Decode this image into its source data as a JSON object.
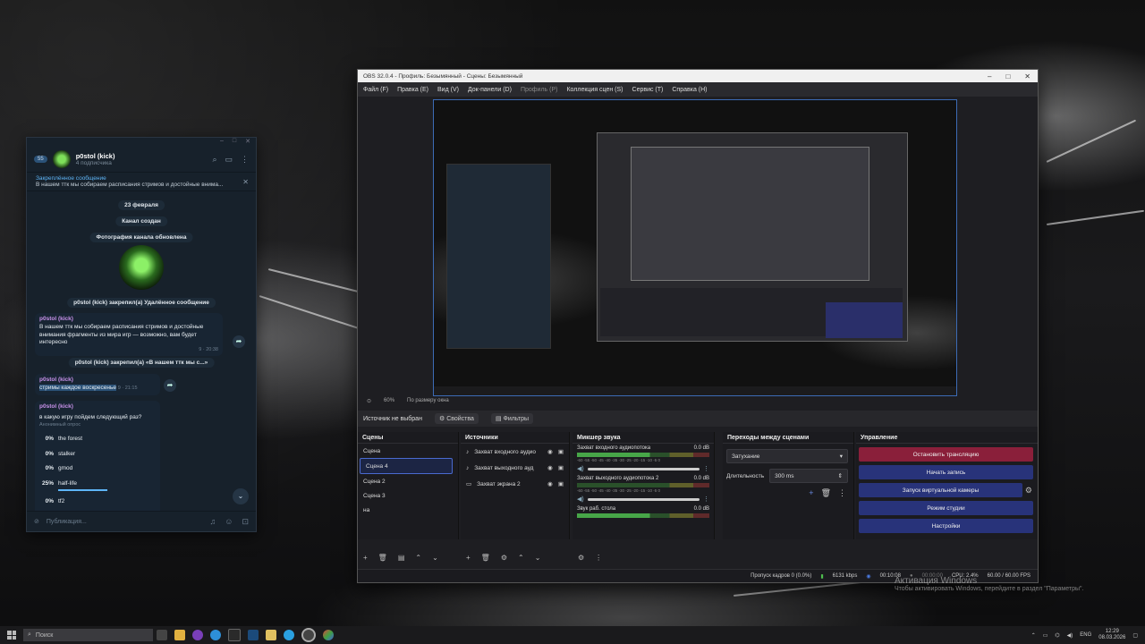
{
  "telegram": {
    "back_badge": "55",
    "channel_name": "p0stol (kick)",
    "subscribers": "4 подписчика",
    "pinned_title": "Закреплённое сообщение",
    "pinned_text": "В нашем ттк мы собираем расписания стримов и достойные внима...",
    "date_label": "23 февраля",
    "svc_created": "Канал создан",
    "svc_photo": "Фотография канала обновлена",
    "svc_pinned_deleted": "p0stol (kick) закрепил(а) Удалённое сообщение",
    "msg1_author": "p0stol (kick)",
    "msg1_text": "В нашем ттк мы собираем расписания стримов и достойные внимания фрагменты из мира игр — возможно, вам будет интересно",
    "msg1_meta": "9 · 20:38",
    "svc_pinned2": "p0stol (kick) закрепил(а) «В нашем ттк мы с...»",
    "msg2_author": "p0stol (kick)",
    "msg2_text": "стримы каждое воскресенье",
    "msg2_meta": "9 · 21:15",
    "poll_author": "p0stol (kick)",
    "poll_question": "в какую игру пойдем следующий раз?",
    "poll_type": "Анонимный опрос",
    "poll_options": [
      {
        "pct": "0%",
        "label": "the forest"
      },
      {
        "pct": "0%",
        "label": "stalker"
      },
      {
        "pct": "0%",
        "label": "gmod"
      },
      {
        "pct": "25%",
        "label": "half-life"
      },
      {
        "pct": "0%",
        "label": "tf2"
      }
    ],
    "input_placeholder": "Публикация..."
  },
  "obs": {
    "title": "OBS 32.0.4 - Профиль: Безымянный - Сцены: Безымянный",
    "menu": [
      "Файл (F)",
      "Правка (E)",
      "Вид (V)",
      "Док-панели (D)",
      "Профиль (P)",
      "Коллекция сцен (S)",
      "Сервис (T)",
      "Справка (H)"
    ],
    "zoom": "60%",
    "zoom_mode": "По размеру окна",
    "no_source": "Источник не выбран",
    "props_label": "Свойства",
    "filters_label": "Фильтры",
    "scenes_title": "Сцены",
    "scenes": [
      "Сцена",
      "Сцена 4",
      "Сцена 2",
      "Сцена 3",
      "на"
    ],
    "sources_title": "Источники",
    "sources": [
      "Захват входного аудио",
      "Захват выходного ауд",
      "Захват экрана 2"
    ],
    "mixer_title": "Микшер звука",
    "mixer": [
      {
        "name": "Захват входного аудиопотока",
        "db": "0.0 dB"
      },
      {
        "name": "Захват выходного аудиопотока 2",
        "db": "0.0 dB"
      },
      {
        "name": "Звук раб. стола",
        "db": "0.0 dB"
      }
    ],
    "meter_scale": "-60 -55 -50 -45 -40 -35 -30 -25 -20 -15 -10 -5 0",
    "transitions_title": "Переходы между сценами",
    "transition": "Затухание",
    "duration_label": "Длительность",
    "duration_value": "300 ms",
    "controls_title": "Управление",
    "btn_stop_stream": "Остановить трансляцию",
    "btn_start_record": "Начать запись",
    "btn_virtual_cam": "Запуск виртуальной камеры",
    "btn_studio": "Режим студии",
    "btn_settings": "Настройки",
    "status_dropped": "Пропуск кадров 0 (0.0%)",
    "status_kbps": "6131 kbps",
    "status_live": "00:10:08",
    "status_rec": "00:00:00",
    "status_cpu": "CPU: 2.4%",
    "status_fps": "60.00 / 60.00 FPS"
  },
  "windows": {
    "activation_title": "Активация Windows",
    "activation_text": "Чтобы активировать Windows, перейдите в раздел \"Параметры\".",
    "search_placeholder": "Поиск",
    "lang": "ENG",
    "time": "12:29",
    "date": "08.03.2026"
  },
  "colors": {
    "obs_accent": "#3c6bb5",
    "stop_stream": "#8a1f3a",
    "obs_button": "#28337a",
    "telegram_bg": "#17212b",
    "telegram_link": "#5eb5f7"
  }
}
